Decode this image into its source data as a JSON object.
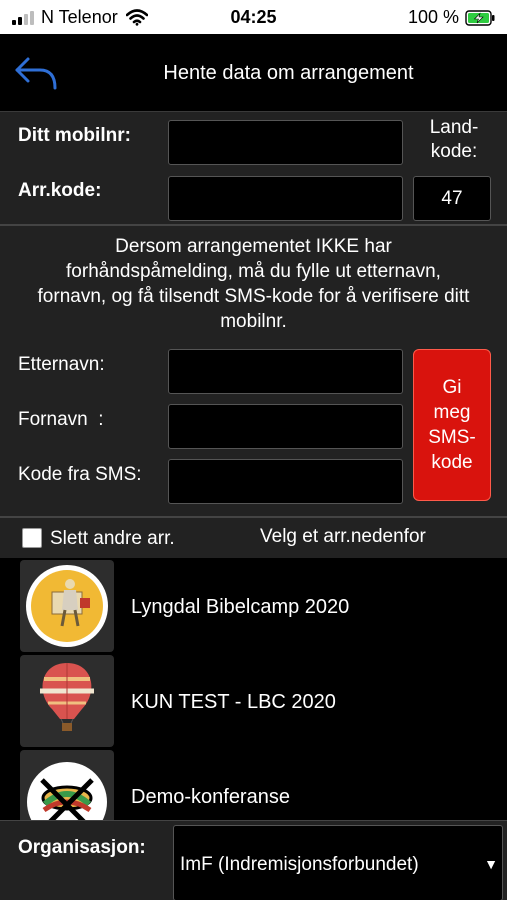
{
  "status": {
    "carrier": "N Telenor",
    "time": "04:25",
    "battery_pct": "100 %",
    "battery_color": "#2ecc40"
  },
  "nav": {
    "title": "Hente data om arrangement",
    "back_icon": "back-arrow-icon",
    "accent": "#2f6fd6"
  },
  "form": {
    "mobile_label": "Ditt mobilnr:",
    "mobile_value": "",
    "country_label": "Land-kode:",
    "country_label_line1": "Land-",
    "country_label_line2": "kode:",
    "country_value": "47",
    "event_code_label": "Arr.kode:",
    "event_code_value": ""
  },
  "info": {
    "lines": [
      "Dersom arrangementet IKKE har",
      "forhåndspåmelding, må du fylle ut etternavn,",
      "fornavn, og få tilsendt SMS-kode for å verifisere ditt",
      "mobilnr."
    ]
  },
  "verify": {
    "lastname_label": "Etternavn:",
    "firstname_label": "Fornavn  :",
    "sms_code_label": "Kode fra SMS:",
    "sms_button_lines": [
      "Gi",
      "meg",
      "SMS-",
      "kode"
    ],
    "sms_button_color": "#d9130d"
  },
  "options": {
    "delete_others_label": "Slett andre arr.",
    "delete_others_checked": false,
    "choose_hint": "Velg et arr.nedenfor"
  },
  "events": [
    {
      "name": "Lyngdal Bibelcamp 2020",
      "icon": "bibelcamp-logo-icon"
    },
    {
      "name": "KUN TEST - LBC 2020",
      "icon": "hot-air-balloon-icon"
    },
    {
      "name": "Demo-konferanse",
      "icon": "demo-logo-icon"
    }
  ],
  "organization": {
    "label": "Organisasjon:",
    "selected": "ImF (Indremisjonsforbundet)"
  }
}
